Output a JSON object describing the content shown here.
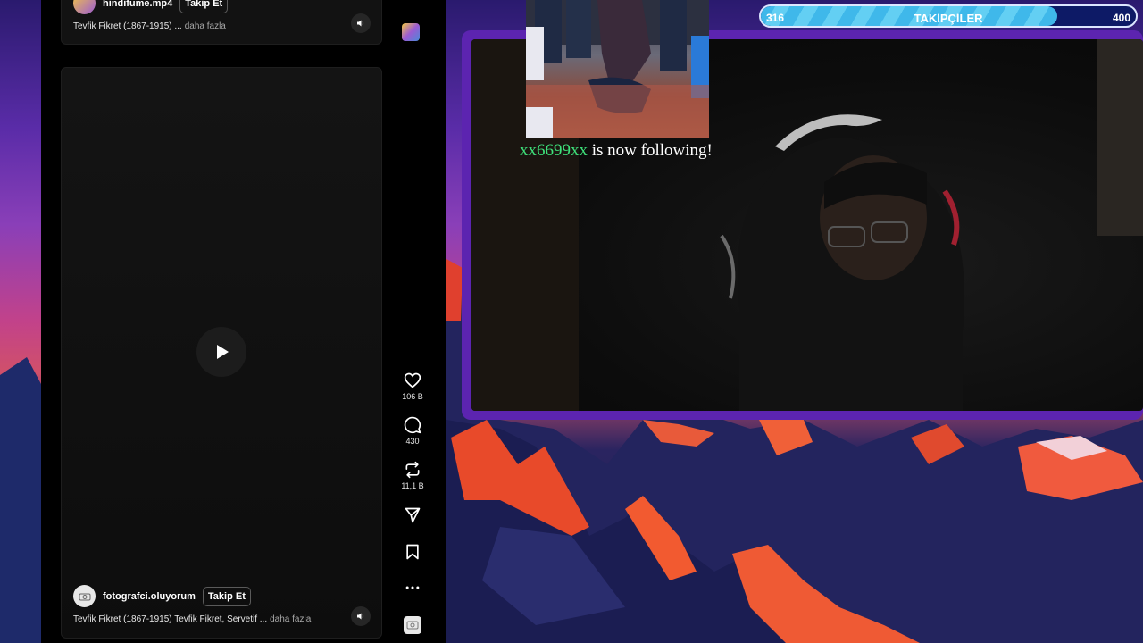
{
  "reels": {
    "top_post": {
      "author": "hindifume.mp4",
      "follow_label": "Takip Et",
      "caption": "Tevfik Fikret (1867-1915) ...",
      "more_label": "daha fazla"
    },
    "main_post": {
      "author": "fotografci.oluyorum",
      "follow_label": "Takip Et",
      "caption": "Tevfik Fikret (1867-1915) Tevfik Fikret, Servetif ...",
      "more_label": "daha fazla"
    },
    "actions": {
      "likes": "106 B",
      "comments": "430",
      "reposts": "11,1 B"
    }
  },
  "stream_overlay": {
    "follower_goal": {
      "current": "316",
      "label": "TAKİPÇİLER",
      "target": "400",
      "progress": 0.79
    },
    "alert": {
      "username": "xx6699xx",
      "message": "is now following!"
    }
  }
}
